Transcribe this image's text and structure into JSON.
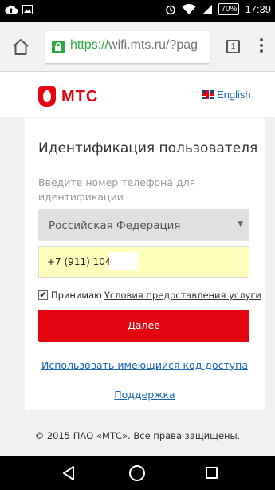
{
  "status_bar": {
    "battery_percent": "70%",
    "time": "17:39",
    "icons": [
      "cloud-upload-icon",
      "image-icon",
      "alarm-icon",
      "wifi-icon",
      "signal-icon",
      "battery-icon"
    ]
  },
  "browser": {
    "url_scheme": "https://",
    "url_rest": "wifi.mts.ru/?pag",
    "tab_count": "1",
    "icons": [
      "home-icon",
      "lock-icon",
      "overflow-menu-icon"
    ]
  },
  "header": {
    "brand": "МТС",
    "language_label": "English",
    "brand_color": "#e30611"
  },
  "form": {
    "title": "Идентификация пользователя",
    "prompt": "Введите номер телефона для идентификации",
    "country_selected": "Российская Федерация",
    "phone_value": "+7 (911) 104-",
    "agree_prefix": "Принимаю",
    "agree_link": "Условия предоставления услуги",
    "agree_checked": true,
    "submit_label": "Далее",
    "code_link": "Использовать имеющийся код доступа",
    "support_link": "Поддержка"
  },
  "footer": {
    "copyright": "© 2015 ПАО «МТС». Все права защищены."
  },
  "colors": {
    "accent": "#e30611",
    "link": "#1a66b8",
    "secure": "#2ea843",
    "autofill": "#ffffbb"
  }
}
